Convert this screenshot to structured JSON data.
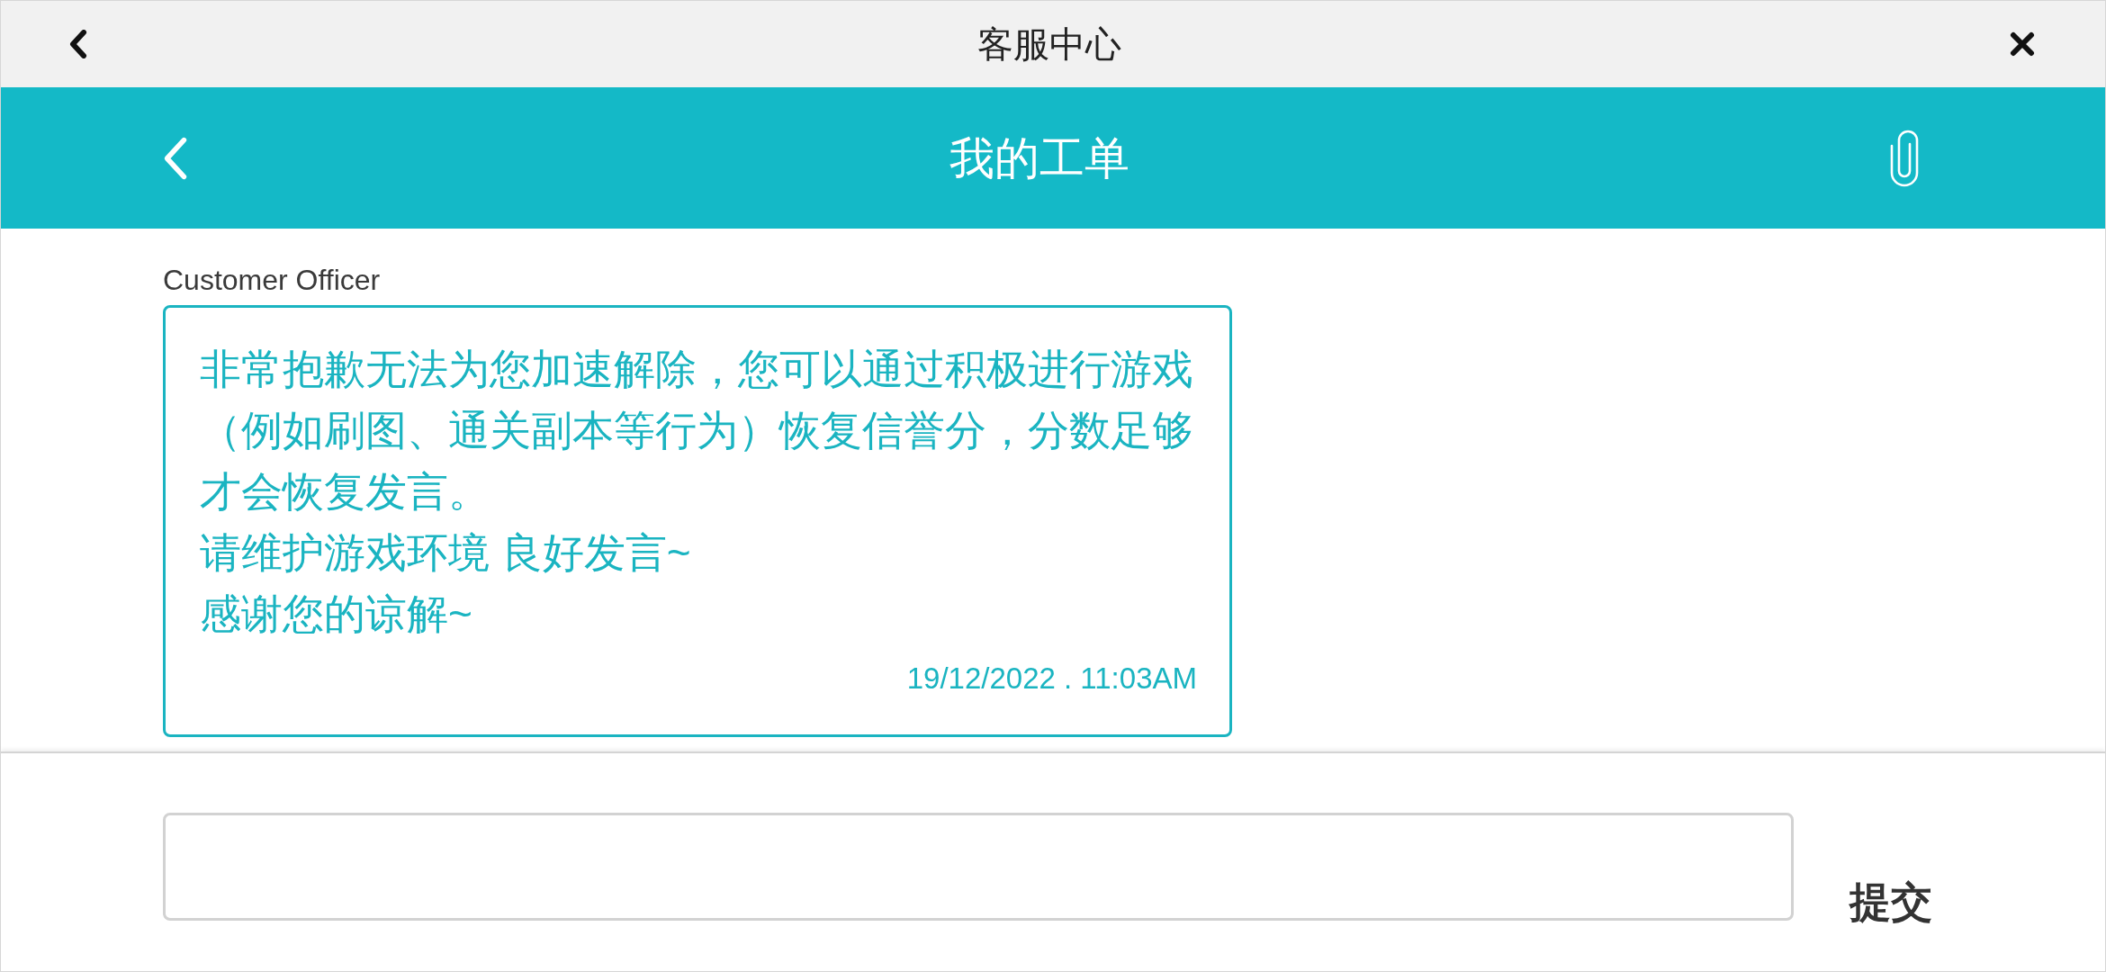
{
  "window": {
    "title": "客服中心"
  },
  "header": {
    "title": "我的工单"
  },
  "messages": [
    {
      "sender": "Customer Officer",
      "paragraphs": [
        "非常抱歉无法为您加速解除，您可以通过积极进行游戏（例如刷图、通关副本等行为）恢复信誉分，分数足够才会恢复发言。",
        "请维护游戏环境 良好发言~",
        "感谢您的谅解~"
      ],
      "time": "19/12/2022 . 11:03AM"
    }
  ],
  "composer": {
    "submit_label": "提交"
  }
}
